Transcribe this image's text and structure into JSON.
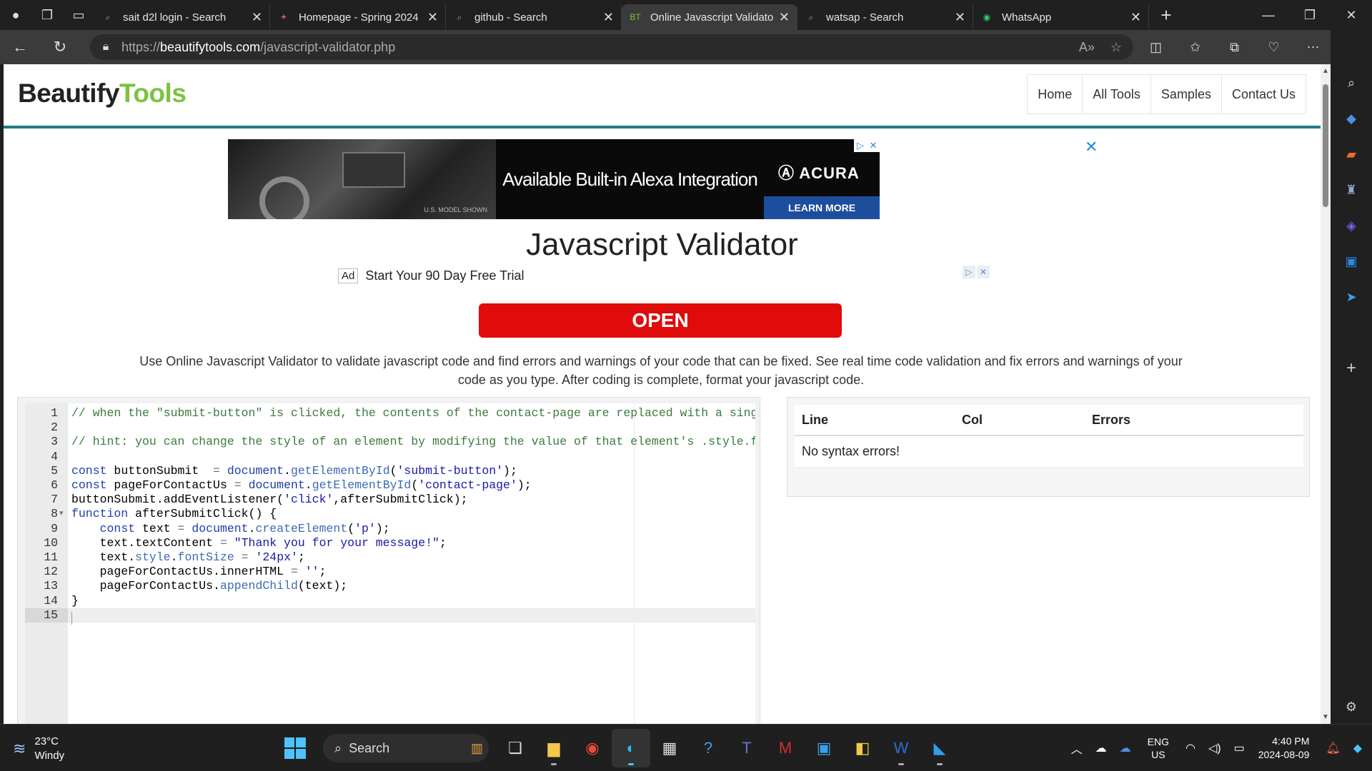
{
  "browser": {
    "tabs": [
      {
        "title": "sait d2l login - Search",
        "icon": "search-icon",
        "active": false
      },
      {
        "title": "Homepage - Spring 2024",
        "icon": "site-favicon",
        "active": false
      },
      {
        "title": "github - Search",
        "icon": "search-icon",
        "active": false
      },
      {
        "title": "Online Javascript Validator",
        "icon": "beautifytools-favicon",
        "active": true
      },
      {
        "title": "watsap - Search",
        "icon": "search-icon",
        "active": false
      },
      {
        "title": "WhatsApp",
        "icon": "whatsapp-icon",
        "active": false
      }
    ],
    "url_prefix": "https://",
    "url_host": "beautifytools.com",
    "url_path": "/javascript-validator.php"
  },
  "site": {
    "logo_part1": "Beautify",
    "logo_part2": "Tools",
    "nav": [
      "Home",
      "All Tools",
      "Samples",
      "Contact Us"
    ]
  },
  "ad_banner": {
    "headline": "Available Built-in Alexa Integration",
    "brand": "ACURA",
    "cta": "LEARN MORE",
    "caption": "U.S. MODEL SHOWN"
  },
  "page": {
    "title": "Javascript Validator",
    "text_ad_badge": "Ad",
    "text_ad": "Start Your 90 Day Free Trial",
    "open_button": "OPEN",
    "description": "Use Online Javascript Validator to validate javascript code and find errors and warnings of your code that can be fixed. See real time code validation and fix errors and warnings of your code as you type. After coding is complete, format your javascript code."
  },
  "editor": {
    "lines": [
      "// when the \"submit-button\" is clicked, the contents of the contact-page are replaced with a singl",
      "",
      "// hint: you can change the style of an element by modifying the value of that element's .style.fo",
      "",
      "const buttonSubmit  = document.getElementById('submit-button');",
      "const pageForContactUs = document.getElementById('contact-page');",
      "buttonSubmit.addEventListener('click',afterSubmitClick);",
      "function afterSubmitClick() {",
      "    const text = document.createElement('p');",
      "    text.textContent = \"Thank you for your message!\";",
      "    text.style.fontSize = '24px';",
      "    pageForContactUs.innerHTML = '';",
      "    pageForContactUs.appendChild(text);",
      "}",
      ""
    ],
    "current_line": 15
  },
  "results": {
    "headers": [
      "Line",
      "Col",
      "Errors"
    ],
    "message": "No syntax errors!"
  },
  "taskbar": {
    "temperature": "23°C",
    "weather": "Windy",
    "search_placeholder": "Search",
    "lang_top": "ENG",
    "lang_bottom": "US",
    "time": "4:40 PM",
    "date": "2024-08-09"
  },
  "colors": {
    "accent_teal": "#1d7b85",
    "logo_green": "#7cc242",
    "open_red": "#e00b0b"
  }
}
